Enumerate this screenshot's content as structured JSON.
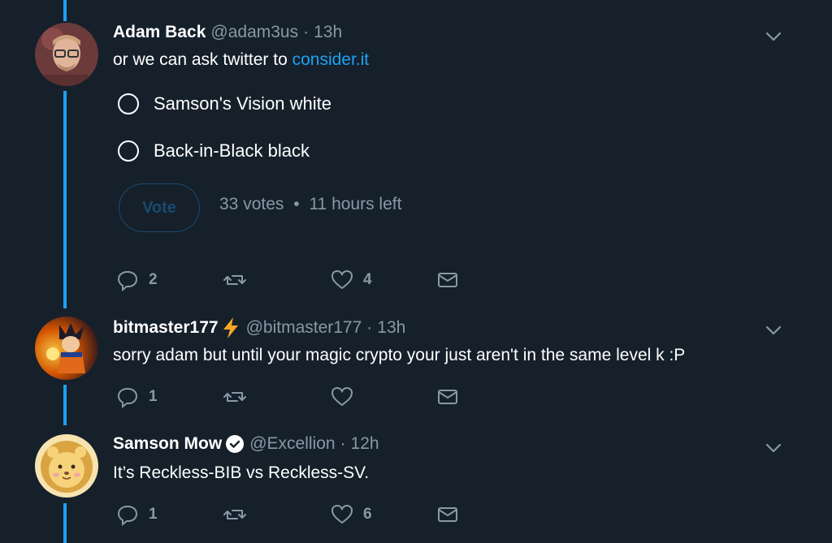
{
  "tweets": [
    {
      "name": "Adam Back",
      "handle": "@adam3us",
      "dot": "·",
      "time": "13h",
      "text_prefix": "or we can ask twitter to ",
      "link": "consider.it",
      "poll": {
        "options": [
          "Samson's Vision white",
          "Back-in-Black black"
        ],
        "vote_label": "Vote",
        "votes": "33 votes",
        "sep": "•",
        "time_left": "11 hours left"
      },
      "actions": {
        "replies": "2",
        "retweets": "",
        "likes": "4"
      }
    },
    {
      "name": "bitmaster177",
      "handle": "@bitmaster177",
      "dot": "·",
      "time": "13h",
      "text": "sorry adam but until your magic crypto your just aren't in the same level k :P",
      "actions": {
        "replies": "1",
        "retweets": "",
        "likes": ""
      }
    },
    {
      "name": "Samson Mow",
      "handle": "@Excellion",
      "dot": "·",
      "time": "12h",
      "text": "It’s Reckless-BIB vs Reckless-SV.",
      "actions": {
        "replies": "1",
        "retweets": "",
        "likes": "6"
      }
    }
  ],
  "colors": {
    "background": "#15202b",
    "accent": "#1da1f2",
    "muted": "#8899a6"
  },
  "icons": [
    "chevron-down-icon",
    "reply-icon",
    "retweet-icon",
    "like-icon",
    "share-icon",
    "verified-icon",
    "lightning-icon"
  ]
}
